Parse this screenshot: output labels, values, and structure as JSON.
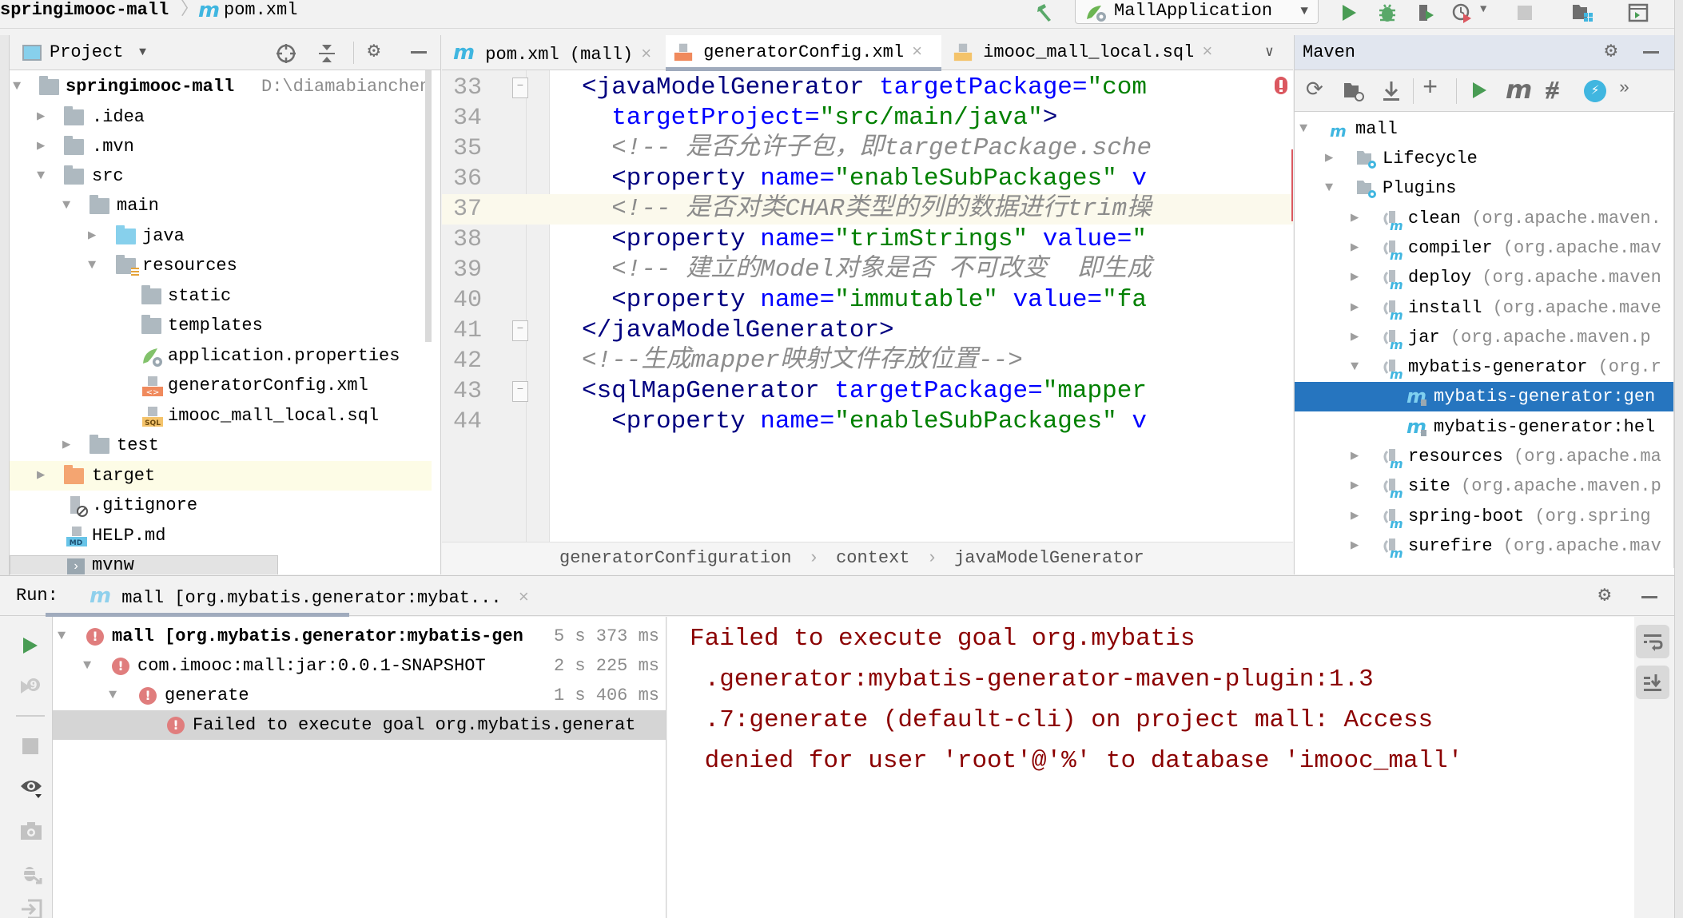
{
  "navbar": {
    "project_name": "springimooc-mall",
    "file_name": "pom.xml",
    "run_config": "MallApplication"
  },
  "project_panel": {
    "title": "Project",
    "items": [
      {
        "label": "springimooc-mall",
        "path": "D:\\diamabianchen"
      },
      {
        "label": ".idea"
      },
      {
        "label": ".mvn"
      },
      {
        "label": "src"
      },
      {
        "label": "main"
      },
      {
        "label": "java"
      },
      {
        "label": "resources"
      },
      {
        "label": "static"
      },
      {
        "label": "templates"
      },
      {
        "label": "application.properties"
      },
      {
        "label": "generatorConfig.xml"
      },
      {
        "label": "imooc_mall_local.sql"
      },
      {
        "label": "test"
      },
      {
        "label": "target"
      },
      {
        "label": ".gitignore"
      },
      {
        "label": "HELP.md"
      },
      {
        "label": "mvnw"
      }
    ]
  },
  "editor": {
    "tabs": [
      {
        "label": "pom.xml (mall)"
      },
      {
        "label": "generatorConfig.xml",
        "active": true
      },
      {
        "label": "imooc_mall_local.sql"
      }
    ],
    "lines": [
      {
        "num": "33",
        "parts": [
          [
            "tag",
            "<javaModelGenerator "
          ],
          [
            "attr",
            "targetPackage="
          ],
          [
            "val",
            "\"com"
          ]
        ]
      },
      {
        "num": "34",
        "parts": [
          [
            "attr",
            "  targetProject="
          ],
          [
            "val",
            "\"src/main/java\""
          ],
          [
            "tag",
            ">"
          ]
        ]
      },
      {
        "num": "35",
        "parts": [
          [
            "cmt",
            "  <!-- 是否允许子包，即targetPackage.sche"
          ]
        ]
      },
      {
        "num": "36",
        "parts": [
          [
            "tag",
            "  <property "
          ],
          [
            "attr",
            "name="
          ],
          [
            "val",
            "\"enableSubPackages\""
          ],
          [
            "attr",
            " v"
          ]
        ]
      },
      {
        "num": "37",
        "parts": [
          [
            "cmt",
            "  <!-- 是否对类CHAR类型的列的数据进行trim操"
          ]
        ]
      },
      {
        "num": "38",
        "parts": [
          [
            "tag",
            "  <property "
          ],
          [
            "attr",
            "name="
          ],
          [
            "val",
            "\"trimStrings\""
          ],
          [
            "attr",
            " value="
          ],
          [
            "val",
            "\""
          ]
        ]
      },
      {
        "num": "39",
        "parts": [
          [
            "cmt",
            "  <!-- 建立的Model对象是否 不可改变  即生成"
          ]
        ]
      },
      {
        "num": "40",
        "parts": [
          [
            "tag",
            "  <property "
          ],
          [
            "attr",
            "name="
          ],
          [
            "val",
            "\"immutable\""
          ],
          [
            "attr",
            " value="
          ],
          [
            "val",
            "\"fa"
          ]
        ]
      },
      {
        "num": "41",
        "parts": [
          [
            "tag",
            "</javaModelGenerator>"
          ]
        ]
      },
      {
        "num": "42",
        "parts": [
          [
            "cmt",
            "<!--生成mapper映射文件存放位置-->"
          ]
        ]
      },
      {
        "num": "43",
        "parts": [
          [
            "tag",
            "<sqlMapGenerator "
          ],
          [
            "attr",
            "targetPackage="
          ],
          [
            "val",
            "\"mapper"
          ]
        ]
      },
      {
        "num": "44",
        "parts": [
          [
            "tag",
            "  <property "
          ],
          [
            "attr",
            "name="
          ],
          [
            "val",
            "\"enableSubPackages\""
          ],
          [
            "attr",
            " v"
          ]
        ]
      }
    ],
    "breadcrumb": [
      "generatorConfiguration",
      "context",
      "javaModelGenerator"
    ]
  },
  "maven": {
    "title": "Maven",
    "root": "mall",
    "items": [
      {
        "label": "Lifecycle",
        "kind": "folder"
      },
      {
        "label": "Plugins",
        "kind": "folder"
      },
      {
        "label": "clean",
        "suffix": "(org.apache.maven."
      },
      {
        "label": "compiler",
        "suffix": "(org.apache.mav"
      },
      {
        "label": "deploy",
        "suffix": "(org.apache.maven"
      },
      {
        "label": "install",
        "suffix": "(org.apache.mave"
      },
      {
        "label": "jar",
        "suffix": "(org.apache.maven.p"
      },
      {
        "label": "mybatis-generator",
        "suffix": "(org.r"
      },
      {
        "label": "mybatis-generator:gen",
        "kind": "goal",
        "selected": true
      },
      {
        "label": "mybatis-generator:hel",
        "kind": "goal"
      },
      {
        "label": "resources",
        "suffix": "(org.apache.ma"
      },
      {
        "label": "site",
        "suffix": "(org.apache.maven.p"
      },
      {
        "label": "spring-boot",
        "suffix": "(org.spring"
      },
      {
        "label": "surefire",
        "suffix": "(org.apache.mav"
      }
    ]
  },
  "run": {
    "label": "Run:",
    "tab_title": "mall [org.mybatis.generator:mybat...",
    "tree": [
      {
        "label": "mall [org.mybatis.generator:mybatis-gen",
        "time": "5 s 373 ms"
      },
      {
        "label": "com.imooc:mall:jar:0.0.1-SNAPSHOT",
        "time": "2 s 225 ms"
      },
      {
        "label": "generate",
        "time": "1 s 406 ms"
      },
      {
        "label": "Failed to execute goal org.mybatis.generat",
        "time": ""
      }
    ],
    "console": [
      "Failed to execute goal org.mybatis",
      " .generator:mybatis-generator-maven-plugin:1.3",
      " .7:generate (default-cli) on project mall: Access",
      " denied for user 'root'@'%' to database 'imooc_mall'"
    ]
  },
  "colors": {
    "selection": "#2675bf",
    "error": "#e07d7d",
    "console_error": "#8b0000",
    "run_green": "#499c54",
    "maven_blue": "#40b6e0"
  }
}
